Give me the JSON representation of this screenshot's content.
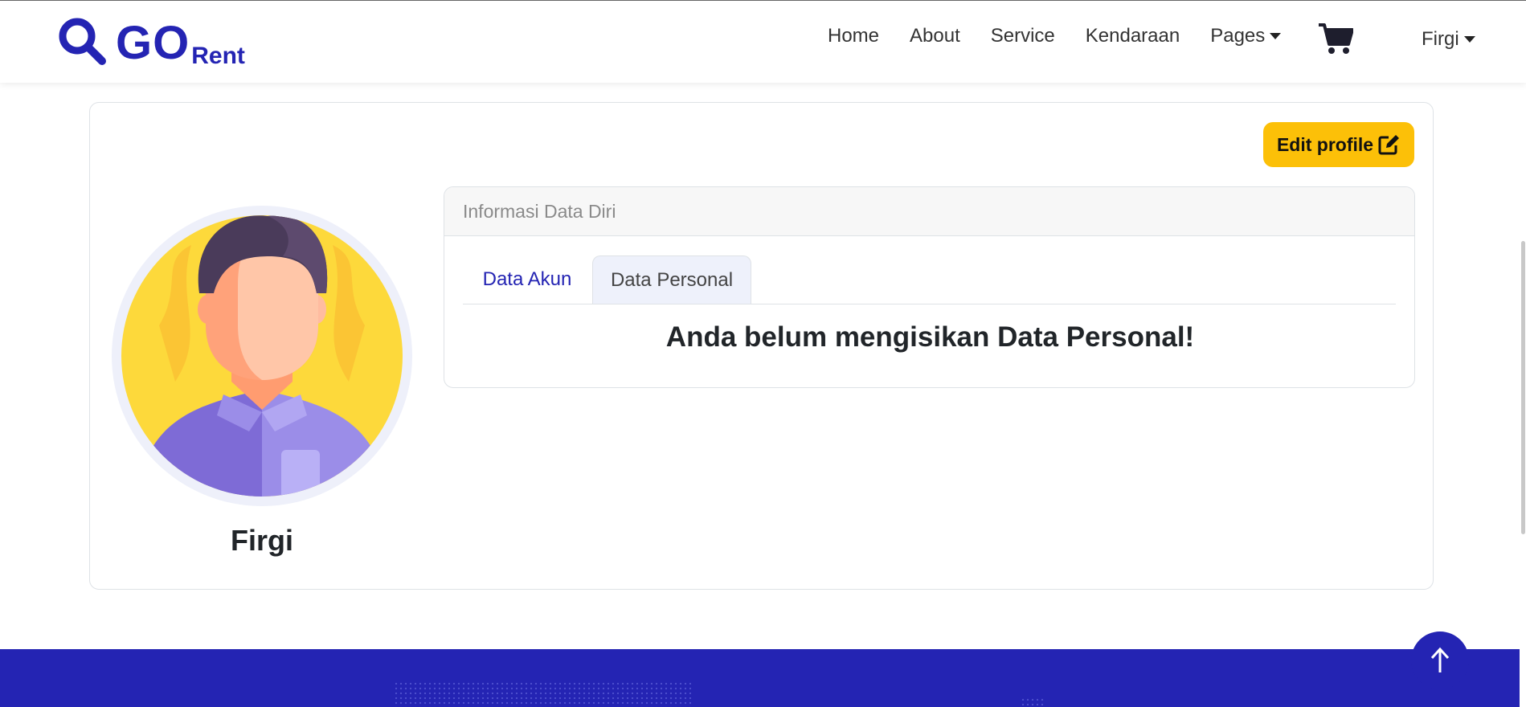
{
  "brand": {
    "go": "GO",
    "rent": "Rent",
    "icon": "search-icon"
  },
  "nav": {
    "items": [
      "Home",
      "About",
      "Service",
      "Kendaraan",
      "Pages"
    ],
    "cart_icon": "cart-icon",
    "user": "Firgi"
  },
  "profile": {
    "edit_label": "Edit profile",
    "edit_icon": "edit-icon",
    "name": "Firgi",
    "accent_color": "#fcc008"
  },
  "info": {
    "header": "Informasi Data Diri",
    "tabs": [
      "Data Akun",
      "Data Personal"
    ],
    "active_tab": "Data Personal",
    "message": "Anda belum mengisikan Data Personal!"
  },
  "footer": {
    "color": "#2424b3",
    "back_to_top_icon": "arrow-up-icon"
  }
}
